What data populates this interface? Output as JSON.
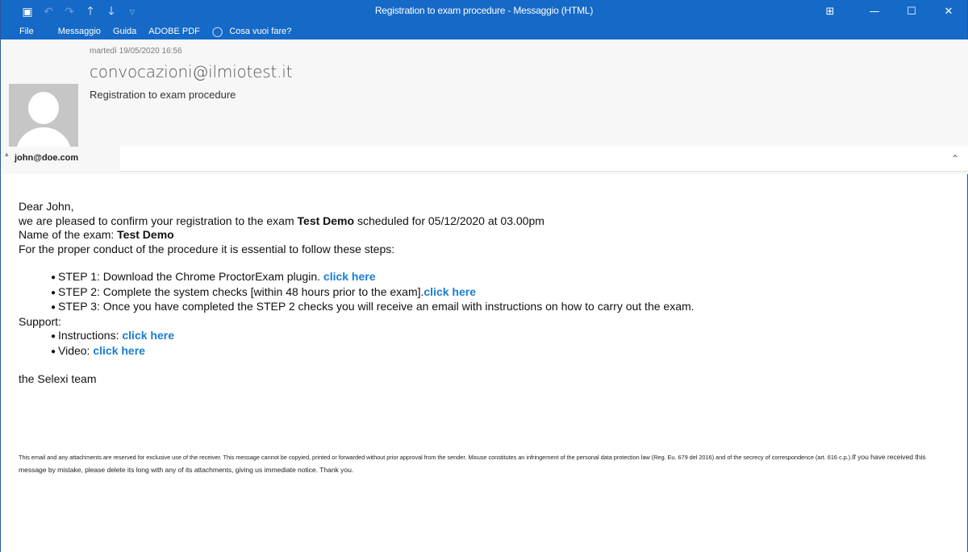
{
  "window": {
    "title": "Registration to exam procedure  -  Messaggio (HTML)",
    "qat": {
      "save_icon": "▣",
      "undo_icon": "↶",
      "redo_icon": "↷",
      "up_icon": "🡑",
      "down_icon": "🡓",
      "customize_icon": "▿"
    },
    "controls": {
      "ribbon_display_icon": "⊞",
      "minimize_icon": "—",
      "maximize_icon": "☐",
      "close_icon": "✕"
    }
  },
  "ribbon": {
    "tabs": [
      {
        "label": "File"
      },
      {
        "label": "Messaggio"
      },
      {
        "label": "Guida"
      },
      {
        "label": "ADOBE PDF"
      }
    ],
    "tell_me": "Cosa vuoi fare?"
  },
  "header": {
    "date": "martedì 19/05/2020 16:56",
    "from": "convocazioni@ilmiotest.it",
    "subject": "Registration to exam procedure",
    "to": "john@doe.com"
  },
  "body": {
    "greeting": "Dear John,",
    "confirm_pre": "we are pleased to confirm your registration to the exam ",
    "exam_name": "Test Demo",
    "confirm_post": " scheduled for 05/12/2020 at 03.00pm",
    "name_label": "Name of the exam: ",
    "instructions_intro": "For the proper conduct of the procedure it is essential to follow these steps:",
    "steps": [
      {
        "text": "STEP 1: Download the Chrome ProctorExam plugin. ",
        "link": "click here"
      },
      {
        "text": "STEP 2: Complete the system checks [within 48 hours prior to the exam].",
        "link": "click here"
      },
      {
        "text": "STEP 3: Once you have completed the STEP 2 checks you will receive an email with instructions on how to carry out the exam.",
        "link": ""
      }
    ],
    "support_label": "Support:",
    "support_items": [
      {
        "text": "Instructions: ",
        "link": "click here"
      },
      {
        "text": "Video: ",
        "link": "click here"
      }
    ],
    "signature": "the Selexi team",
    "disclaimer_part1": "This email and any attachments are reserved for exclusive use of the receiver. This message cannot be copyied, printed or forwarded without prior approval from the sender. Misuse constitutes an infringement of the personal data protection law (Reg. Eu. 679 del 2016) and of the secrecy of correspondence (art. 616 c.p.).",
    "disclaimer_part2": "If you have received this message by mistake, please delete its long with any of its attachments, giving us immediate notice. Thank you."
  },
  "colors": {
    "titlebar": "#1569c7",
    "link": "#1a7dd4"
  }
}
